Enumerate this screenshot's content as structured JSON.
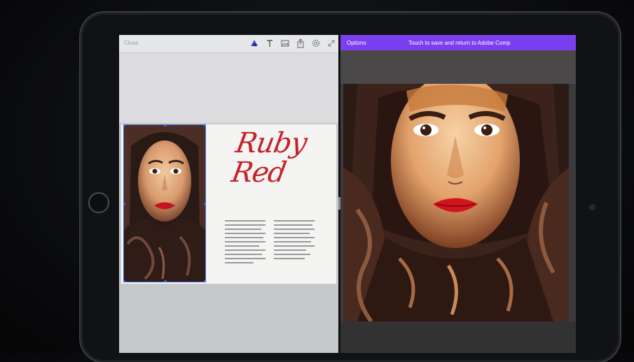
{
  "left_pane": {
    "toolbar": {
      "close_label": "Close",
      "icons": [
        "shape-icon",
        "text-icon",
        "image-icon",
        "share-icon",
        "settings-icon",
        "expand-icon"
      ]
    },
    "layout": {
      "title_line1": "Ruby",
      "title_line2": "Red"
    }
  },
  "right_pane": {
    "header": {
      "options_label": "Options",
      "save_message": "Touch to save and return to Adobe Comp"
    }
  },
  "colors": {
    "accent_purple": "#7c3ff0",
    "title_red": "#c8202a",
    "selection_blue": "#3b6fe0"
  }
}
